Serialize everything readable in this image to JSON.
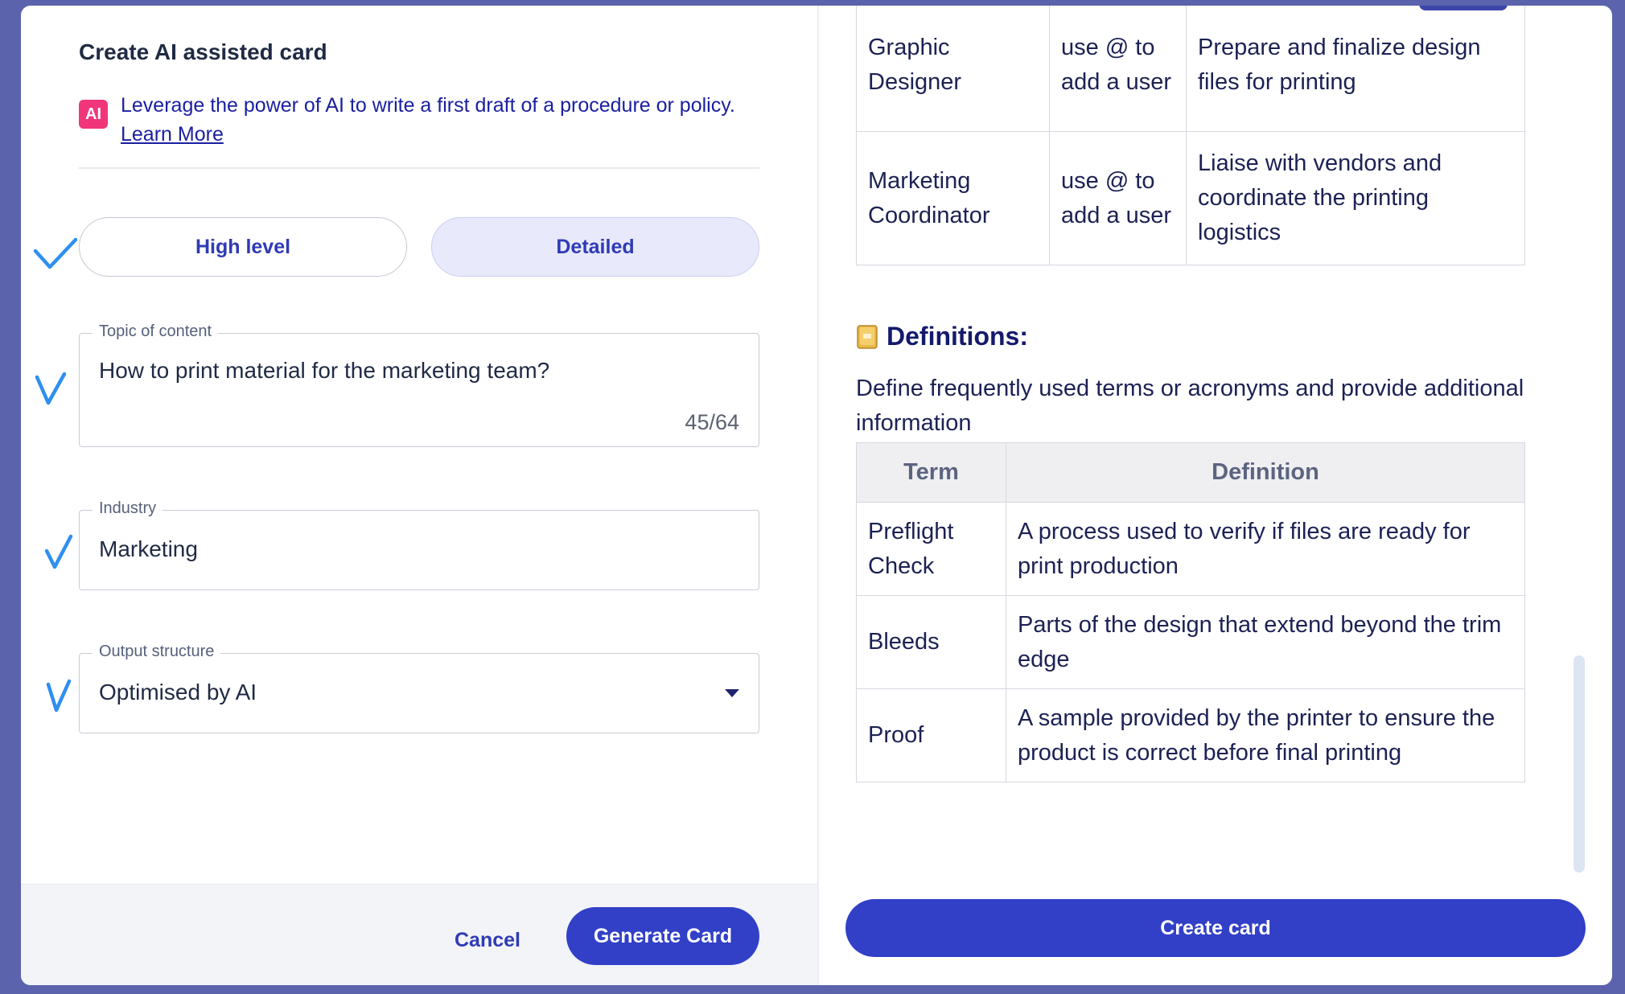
{
  "header": {
    "title": "Create AI assisted card",
    "ai_badge": "AI",
    "ai_description": "Leverage the power of AI to write a first draft of a procedure or policy.",
    "learn_more": "Learn More"
  },
  "detail_level": {
    "options": [
      "High level",
      "Detailed"
    ],
    "selected": "Detailed"
  },
  "fields": {
    "topic": {
      "label": "Topic of content",
      "value": "How to print material for the marketing team?",
      "counter": "45/64"
    },
    "industry": {
      "label": "Industry",
      "value": "Marketing"
    },
    "output": {
      "label": "Output structure",
      "value": "Optimised by AI"
    }
  },
  "footer": {
    "cancel": "Cancel",
    "generate": "Generate Card",
    "create": "Create card"
  },
  "preview": {
    "roles": [
      {
        "role": "Graphic Designer",
        "user": "use @ to add a user",
        "task": "Prepare and finalize design files for printing"
      },
      {
        "role": "Marketing Coordinator",
        "user": "use @ to add a user",
        "task": "Liaise with vendors and coordinate the printing logistics"
      }
    ],
    "definitions": {
      "title": "Definitions:",
      "description": "Define frequently used terms or acronyms and provide additional information",
      "headers": [
        "Term",
        "Definition"
      ],
      "rows": [
        {
          "term": "Preflight Check",
          "definition": "A process used to verify if files are ready for print production"
        },
        {
          "term": "Bleeds",
          "definition": "Parts of the design that extend beyond the trim edge"
        },
        {
          "term": "Proof",
          "definition": "A sample provided by the printer to ensure the product is correct before final printing"
        }
      ]
    }
  },
  "colors": {
    "accent": "#3140c7",
    "ai_badge": "#f0357b",
    "check": "#2e8ff0"
  }
}
